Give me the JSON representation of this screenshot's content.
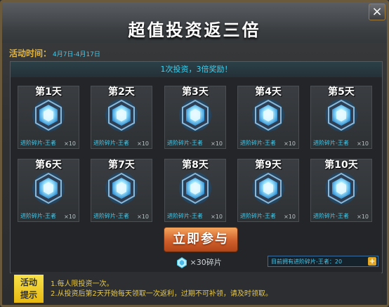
{
  "window": {
    "title": "超值投资返三倍",
    "close_label": "×"
  },
  "activity": {
    "time_label": "活动时间：",
    "dates": "4月7日-4月17日"
  },
  "banner": "1次投资，3倍奖励！",
  "days": [
    {
      "label": "第1天",
      "reward": "进阶碎片-王者",
      "qty": "×10"
    },
    {
      "label": "第2天",
      "reward": "进阶碎片-王者",
      "qty": "×10"
    },
    {
      "label": "第3天",
      "reward": "进阶碎片-王者",
      "qty": "×10"
    },
    {
      "label": "第4天",
      "reward": "进阶碎片-王者",
      "qty": "×10"
    },
    {
      "label": "第5天",
      "reward": "进阶碎片-王者",
      "qty": "×10"
    },
    {
      "label": "第6天",
      "reward": "进阶碎片-王者",
      "qty": "×10"
    },
    {
      "label": "第7天",
      "reward": "进阶碎片-王者",
      "qty": "×10"
    },
    {
      "label": "第8天",
      "reward": "进阶碎片-王者",
      "qty": "×10"
    },
    {
      "label": "第9天",
      "reward": "进阶碎片-王者",
      "qty": "×10"
    },
    {
      "label": "第10天",
      "reward": "进阶碎片-王者",
      "qty": "×10"
    }
  ],
  "join_button": "立即参与",
  "cost": "×30碎片",
  "owned": "目前拥有进阶碎片-王者：20",
  "plus_label": "+",
  "tips": {
    "label_line1": "活动",
    "label_line2": "提示",
    "lines": [
      "1.每人限投资一次。",
      "2.从投资后第2天开始每天领取一次返利，过期不可补领，请及时领取。"
    ]
  },
  "colors": {
    "accent_cyan": "#49c8e8",
    "button_orange": "#d0602c",
    "tip_yellow": "#e8c94a"
  }
}
